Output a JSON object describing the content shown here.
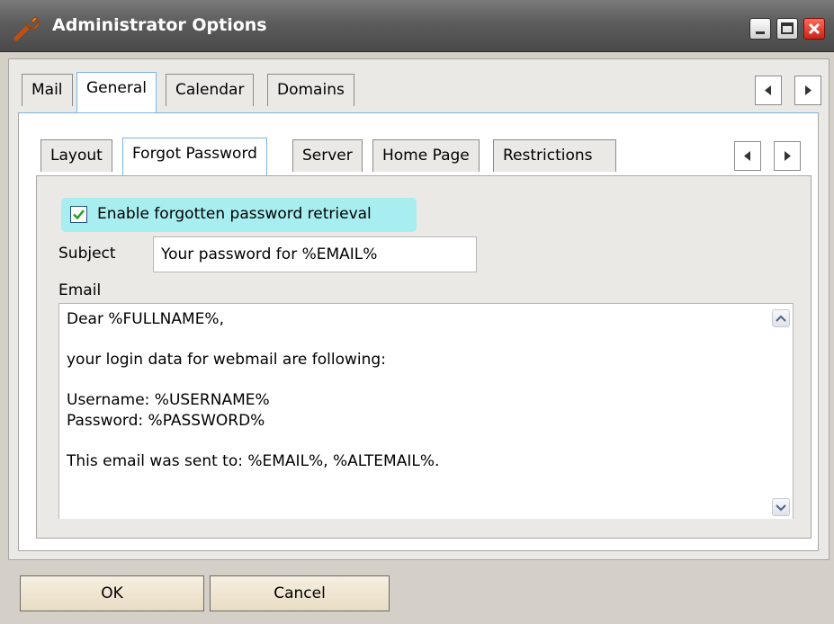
{
  "window": {
    "title": "Administrator Options",
    "icons": {
      "app": "wrench-icon",
      "minimize": "minimize-icon",
      "maximize": "maximize-icon",
      "close": "close-icon"
    }
  },
  "outer_tabs": [
    "Mail",
    "General",
    "Calendar",
    "Domains"
  ],
  "outer_selected": "General",
  "inner_tabs": [
    "Layout",
    "Forgot Password",
    "Server",
    "Home Page",
    "Restrictions"
  ],
  "inner_selected": "Forgot Password",
  "form": {
    "enable_label": "Enable forgotten password retrieval",
    "enable_checked": true,
    "subject_label": "Subject",
    "subject_value": "Your password for %EMAIL%",
    "email_label": "Email",
    "email_body": "Dear %FULLNAME%,\n\nyour login data for webmail are following:\n\nUsername: %USERNAME%\nPassword: %PASSWORD%\n\nThis email was sent to: %EMAIL%, %ALTEMAIL%."
  },
  "buttons": {
    "ok": "OK",
    "cancel": "Cancel"
  },
  "colors": {
    "checkbox_highlight": "#a8eef0",
    "selected_tab_border": "#7cb4e8",
    "title_bar": "#5c5c5c"
  }
}
